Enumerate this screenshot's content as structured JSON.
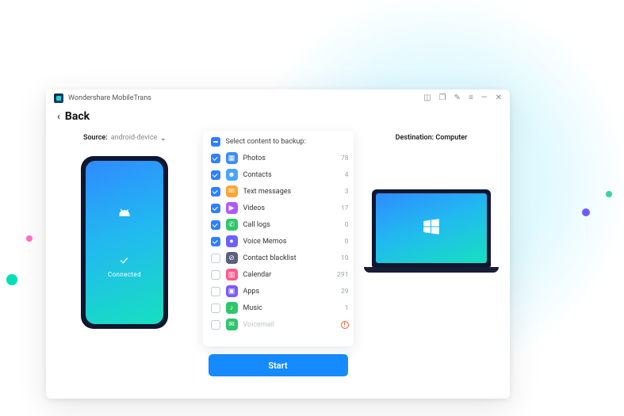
{
  "app": {
    "title": "Wondershare MobileTrans"
  },
  "nav": {
    "back_label": "Back"
  },
  "source": {
    "label": "Source:",
    "device": "android-device"
  },
  "destination": {
    "label": "Destination: Computer"
  },
  "phone": {
    "status": "Connected"
  },
  "list": {
    "header": "Select content to backup:",
    "items": [
      {
        "icon": "photos",
        "color": "#3a8cff",
        "label": "Photos",
        "count": "78",
        "checked": true
      },
      {
        "icon": "contacts",
        "color": "#4aa4ff",
        "label": "Contacts",
        "count": "4",
        "checked": true
      },
      {
        "icon": "messages",
        "color": "#ffa63a",
        "label": "Text messages",
        "count": "3",
        "checked": true
      },
      {
        "icon": "videos",
        "color": "#b05bff",
        "label": "Videos",
        "count": "17",
        "checked": true
      },
      {
        "icon": "calllogs",
        "color": "#2fc56a",
        "label": "Call logs",
        "count": "0",
        "checked": true
      },
      {
        "icon": "voicememos",
        "color": "#6a62ff",
        "label": "Voice Memos",
        "count": "0",
        "checked": true
      },
      {
        "icon": "blacklist",
        "color": "#5a5f7a",
        "label": "Contact blacklist",
        "count": "10",
        "checked": false
      },
      {
        "icon": "calendar",
        "color": "#ff5a8c",
        "label": "Calendar",
        "count": "291",
        "checked": false
      },
      {
        "icon": "apps",
        "color": "#7a5bff",
        "label": "Apps",
        "count": "29",
        "checked": false
      },
      {
        "icon": "music",
        "color": "#2fc56a",
        "label": "Music",
        "count": "1",
        "checked": false
      },
      {
        "icon": "voicemail",
        "color": "#2fc56a",
        "label": "Voicemail",
        "count": "!",
        "checked": false,
        "disabled": true
      }
    ]
  },
  "actions": {
    "start_label": "Start"
  }
}
